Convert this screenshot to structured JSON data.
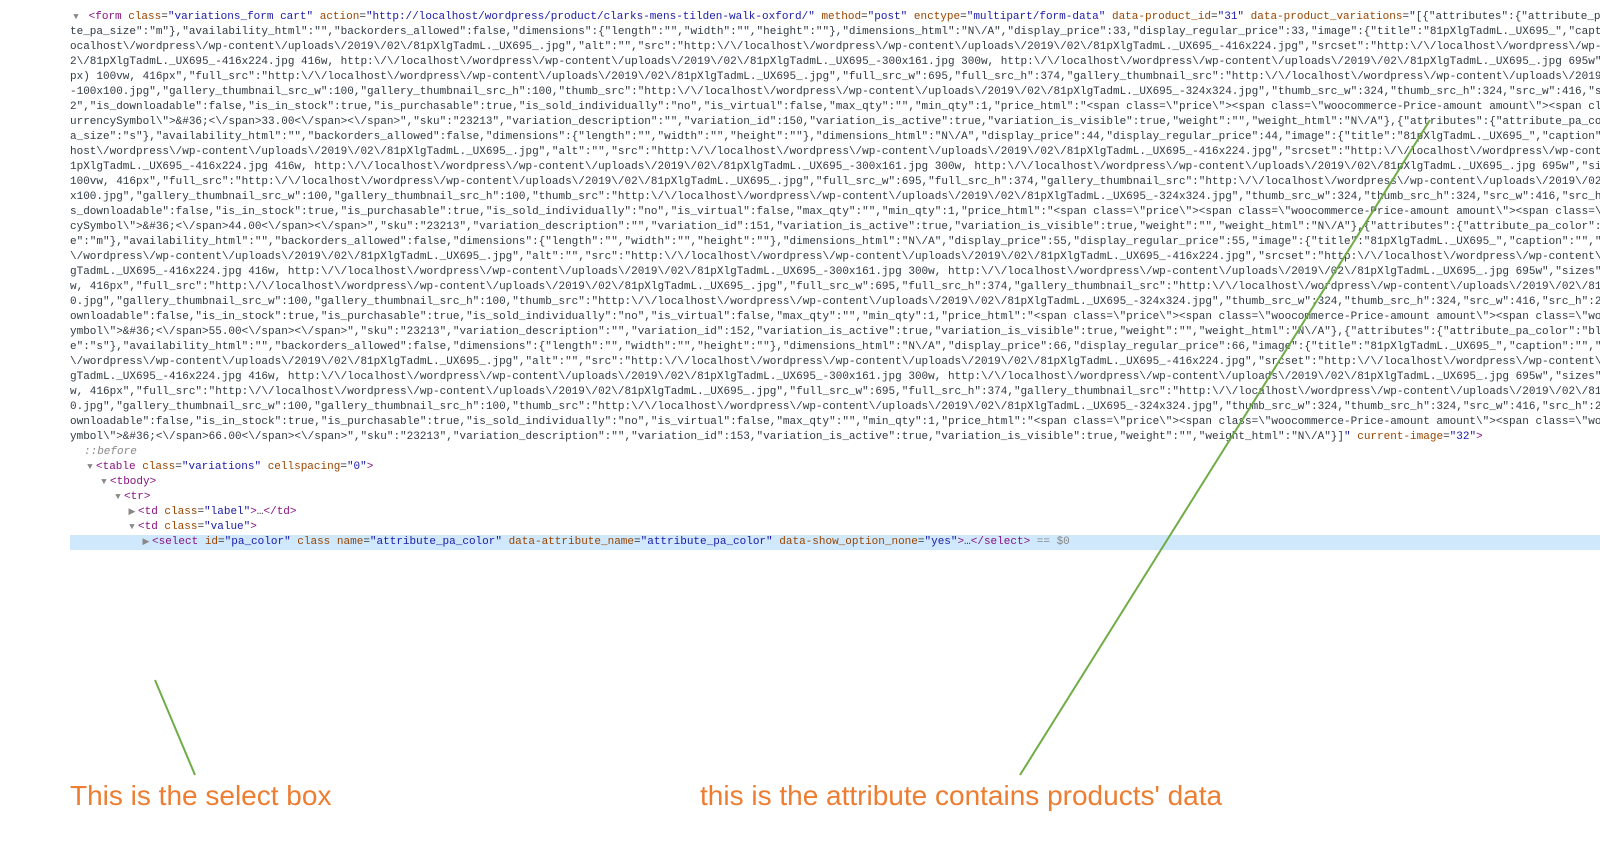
{
  "form": {
    "tag": "form",
    "class": "variations_form cart",
    "action": "http://localhost/wordpress/product/clarks-mens-tilden-walk-oxford/",
    "method": "post",
    "enctype": "multipart/form-data",
    "data_product_id": "31",
    "current_image_attr": "current-image",
    "current_image_val": "32",
    "variations_attr": "data-product_variations",
    "variations_json": "[{\"attributes\":{\"attribute_pa_color\":\"black\",\"attribute_pa_size\":\"m\"},\"availability_html\":\"\",\"backorders_allowed\":false,\"dimensions\":{\"length\":\"\",\"width\":\"\",\"height\":\"\"},\"dimensions_html\":\"N\\/A\",\"display_price\":33,\"display_regular_price\":33,\"image\":{\"title\":\"81pXlgTadmL._UX695_\",\"caption\":\"\",\"url\":\"http:\\/\\/localhost\\/wordpress\\/wp-content\\/uploads\\/2019\\/02\\/81pXlgTadmL._UX695_.jpg\",\"alt\":\"\",\"src\":\"http:\\/\\/localhost\\/wordpress\\/wp-content\\/uploads\\/2019\\/02\\/81pXlgTadmL._UX695_-416x224.jpg\",\"srcset\":\"http:\\/\\/localhost\\/wordpress\\/wp-content\\/uploads\\/2019\\/02\\/81pXlgTadmL._UX695_-416x224.jpg 416w, http:\\/\\/localhost\\/wordpress\\/wp-content\\/uploads\\/2019\\/02\\/81pXlgTadmL._UX695_-300x161.jpg 300w, http:\\/\\/localhost\\/wordpress\\/wp-content\\/uploads\\/2019\\/02\\/81pXlgTadmL._UX695_.jpg 695w\",\"sizes\":\"(max-width: 416px) 100vw, 416px\",\"full_src\":\"http:\\/\\/localhost\\/wordpress\\/wp-content\\/uploads\\/2019\\/02\\/81pXlgTadmL._UX695_.jpg\",\"full_src_w\":695,\"full_src_h\":374,\"gallery_thumbnail_src\":\"http:\\/\\/localhost\\/wordpress\\/wp-content\\/uploads\\/2019\\/02\\/81pXlgTadmL._UX695_-100x100.jpg\",\"gallery_thumbnail_src_w\":100,\"gallery_thumbnail_src_h\":100,\"thumb_src\":\"http:\\/\\/localhost\\/wordpress\\/wp-content\\/uploads\\/2019\\/02\\/81pXlgTadmL._UX695_-324x324.jpg\",\"thumb_src_w\":324,\"thumb_src_h\":324,\"src_w\":416,\"src_h\":224},\"image_id\":\"32\",\"is_downloadable\":false,\"is_in_stock\":true,\"is_purchasable\":true,\"is_sold_individually\":\"no\",\"is_virtual\":false,\"max_qty\":\"\",\"min_qty\":1,\"price_html\":\"<span class=\\\"price\\\"><span class=\\\"woocommerce-Price-amount amount\\\"><span class=\\\"woocommerce-Price-currencySymbol\\\">&#36;<\\/span>33.00<\\/span><\\/span>\",\"sku\":\"23213\",\"variation_description\":\"\",\"variation_id\":150,\"variation_is_active\":true,\"variation_is_visible\":true,\"weight\":\"\",\"weight_html\":\"N\\/A\"},{\"attributes\":{\"attribute_pa_color\":\"black\",\"attribute_pa_size\":\"s\"},\"availability_html\":\"\",\"backorders_allowed\":false,\"dimensions\":{\"length\":\"\",\"width\":\"\",\"height\":\"\"},\"dimensions_html\":\"N\\/A\",\"display_price\":44,\"display_regular_price\":44,\"image\":{\"title\":\"81pXlgTadmL._UX695_\",\"caption\":\"\",\"url\":\"http:\\/\\/localhost\\/wordpress\\/wp-content\\/uploads\\/2019\\/02\\/81pXlgTadmL._UX695_.jpg\",\"alt\":\"\",\"src\":\"http:\\/\\/localhost\\/wordpress\\/wp-content\\/uploads\\/2019\\/02\\/81pXlgTadmL._UX695_-416x224.jpg\",\"srcset\":\"http:\\/\\/localhost\\/wordpress\\/wp-content\\/uploads\\/2019\\/02\\/81pXlgTadmL._UX695_-416x224.jpg 416w, http:\\/\\/localhost\\/wordpress\\/wp-content\\/uploads\\/2019\\/02\\/81pXlgTadmL._UX695_-300x161.jpg 300w, http:\\/\\/localhost\\/wordpress\\/wp-content\\/uploads\\/2019\\/02\\/81pXlgTadmL._UX695_.jpg 695w\",\"sizes\":\"(max-width: 416px) 100vw, 416px\",\"full_src\":\"http:\\/\\/localhost\\/wordpress\\/wp-content\\/uploads\\/2019\\/02\\/81pXlgTadmL._UX695_.jpg\",\"full_src_w\":695,\"full_src_h\":374,\"gallery_thumbnail_src\":\"http:\\/\\/localhost\\/wordpress\\/wp-content\\/uploads\\/2019\\/02\\/81pXlgTadmL._UX695_-100x100.jpg\",\"gallery_thumbnail_src_w\":100,\"gallery_thumbnail_src_h\":100,\"thumb_src\":\"http:\\/\\/localhost\\/wordpress\\/wp-content\\/uploads\\/2019\\/02\\/81pXlgTadmL._UX695_-324x324.jpg\",\"thumb_src_w\":324,\"thumb_src_h\":324,\"src_w\":416,\"src_h\":224},\"image_id\":\"32\",\"is_downloadable\":false,\"is_in_stock\":true,\"is_purchasable\":true,\"is_sold_individually\":\"no\",\"is_virtual\":false,\"max_qty\":\"\",\"min_qty\":1,\"price_html\":\"<span class=\\\"price\\\"><span class=\\\"woocommerce-Price-amount amount\\\"><span class=\\\"woocommerce-Price-currencySymbol\\\">&#36;<\\/span>44.00<\\/span><\\/span>\",\"sku\":\"23213\",\"variation_description\":\"\",\"variation_id\":151,\"variation_is_active\":true,\"variation_is_visible\":true,\"weight\":\"\",\"weight_html\":\"N\\/A\"},{\"attributes\":{\"attribute_pa_color\":\"blue\",\"attribute_pa_size\":\"m\"},\"availability_html\":\"\",\"backorders_allowed\":false,\"dimensions\":{\"length\":\"\",\"width\":\"\",\"height\":\"\"},\"dimensions_html\":\"N\\/A\",\"display_price\":55,\"display_regular_price\":55,\"image\":{\"title\":\"81pXlgTadmL._UX695_\",\"caption\":\"\",\"url\":\"http:\\/\\/localhost\\/wordpress\\/wp-content\\/uploads\\/2019\\/02\\/81pXlgTadmL._UX695_.jpg\",\"alt\":\"\",\"src\":\"http:\\/\\/localhost\\/wordpress\\/wp-content\\/uploads\\/2019\\/02\\/81pXlgTadmL._UX695_-416x224.jpg\",\"srcset\":\"http:\\/\\/localhost\\/wordpress\\/wp-content\\/uploads\\/2019\\/02\\/81pXlgTadmL._UX695_-416x224.jpg 416w, http:\\/\\/localhost\\/wordpress\\/wp-content\\/uploads\\/2019\\/02\\/81pXlgTadmL._UX695_-300x161.jpg 300w, http:\\/\\/localhost\\/wordpress\\/wp-content\\/uploads\\/2019\\/02\\/81pXlgTadmL._UX695_.jpg 695w\",\"sizes\":\"(max-width: 416px) 100vw, 416px\",\"full_src\":\"http:\\/\\/localhost\\/wordpress\\/wp-content\\/uploads\\/2019\\/02\\/81pXlgTadmL._UX695_.jpg\",\"full_src_w\":695,\"full_src_h\":374,\"gallery_thumbnail_src\":\"http:\\/\\/localhost\\/wordpress\\/wp-content\\/uploads\\/2019\\/02\\/81pXlgTadmL._UX695_-100x100.jpg\",\"gallery_thumbnail_src_w\":100,\"gallery_thumbnail_src_h\":100,\"thumb_src\":\"http:\\/\\/localhost\\/wordpress\\/wp-content\\/uploads\\/2019\\/02\\/81pXlgTadmL._UX695_-324x324.jpg\",\"thumb_src_w\":324,\"thumb_src_h\":324,\"src_w\":416,\"src_h\":224},\"image_id\":\"32\",\"is_downloadable\":false,\"is_in_stock\":true,\"is_purchasable\":true,\"is_sold_individually\":\"no\",\"is_virtual\":false,\"max_qty\":\"\",\"min_qty\":1,\"price_html\":\"<span class=\\\"price\\\"><span class=\\\"woocommerce-Price-amount amount\\\"><span class=\\\"woocommerce-Price-currencySymbol\\\">&#36;<\\/span>55.00<\\/span><\\/span>\",\"sku\":\"23213\",\"variation_description\":\"\",\"variation_id\":152,\"variation_is_active\":true,\"variation_is_visible\":true,\"weight\":\"\",\"weight_html\":\"N\\/A\"},{\"attributes\":{\"attribute_pa_color\":\"blue\",\"attribute_pa_size\":\"s\"},\"availability_html\":\"\",\"backorders_allowed\":false,\"dimensions\":{\"length\":\"\",\"width\":\"\",\"height\":\"\"},\"dimensions_html\":\"N\\/A\",\"display_price\":66,\"display_regular_price\":66,\"image\":{\"title\":\"81pXlgTadmL._UX695_\",\"caption\":\"\",\"url\":\"http:\\/\\/localhost\\/wordpress\\/wp-content\\/uploads\\/2019\\/02\\/81pXlgTadmL._UX695_.jpg\",\"alt\":\"\",\"src\":\"http:\\/\\/localhost\\/wordpress\\/wp-content\\/uploads\\/2019\\/02\\/81pXlgTadmL._UX695_-416x224.jpg\",\"srcset\":\"http:\\/\\/localhost\\/wordpress\\/wp-content\\/uploads\\/2019\\/02\\/81pXlgTadmL._UX695_-416x224.jpg 416w, http:\\/\\/localhost\\/wordpress\\/wp-content\\/uploads\\/2019\\/02\\/81pXlgTadmL._UX695_-300x161.jpg 300w, http:\\/\\/localhost\\/wordpress\\/wp-content\\/uploads\\/2019\\/02\\/81pXlgTadmL._UX695_.jpg 695w\",\"sizes\":\"(max-width: 416px) 100vw, 416px\",\"full_src\":\"http:\\/\\/localhost\\/wordpress\\/wp-content\\/uploads\\/2019\\/02\\/81pXlgTadmL._UX695_.jpg\",\"full_src_w\":695,\"full_src_h\":374,\"gallery_thumbnail_src\":\"http:\\/\\/localhost\\/wordpress\\/wp-content\\/uploads\\/2019\\/02\\/81pXlgTadmL._UX695_-100x100.jpg\",\"gallery_thumbnail_src_w\":100,\"gallery_thumbnail_src_h\":100,\"thumb_src\":\"http:\\/\\/localhost\\/wordpress\\/wp-content\\/uploads\\/2019\\/02\\/81pXlgTadmL._UX695_-324x324.jpg\",\"thumb_src_w\":324,\"thumb_src_h\":324,\"src_w\":416,\"src_h\":224},\"image_id\":\"32\",\"is_downloadable\":false,\"is_in_stock\":true,\"is_purchasable\":true,\"is_sold_individually\":\"no\",\"is_virtual\":false,\"max_qty\":\"\",\"min_qty\":1,\"price_html\":\"<span class=\\\"price\\\"><span class=\\\"woocommerce-Price-amount amount\\\"><span class=\\\"woocommerce-Price-currencySymbol\\\">&#36;<\\/span>66.00<\\/span><\\/span>\",\"sku\":\"23213\",\"variation_description\":\"\",\"variation_id\":153,\"variation_is_active\":true,\"variation_is_visible\":true,\"weight\":\"\",\"weight_html\":\"N\\/A\"}]"
  },
  "pseudo_before": "::before",
  "table": {
    "tag": "table",
    "class": "variations",
    "cellspacing": "0"
  },
  "tbody": "tbody",
  "tr": "tr",
  "td_label": {
    "tag": "td",
    "class": "label",
    "ell": "…"
  },
  "td_value": {
    "tag": "td",
    "class": "value"
  },
  "select": {
    "tag": "select",
    "id": "pa_color",
    "class_attr": "class",
    "name": "attribute_pa_color",
    "data_attribute_name": "attribute_pa_color",
    "data_show_option_none": "yes",
    "ell": "…",
    "eq": " == $0"
  },
  "callouts": {
    "left": "This is the select box",
    "right": "this is the attribute contains products' data"
  }
}
